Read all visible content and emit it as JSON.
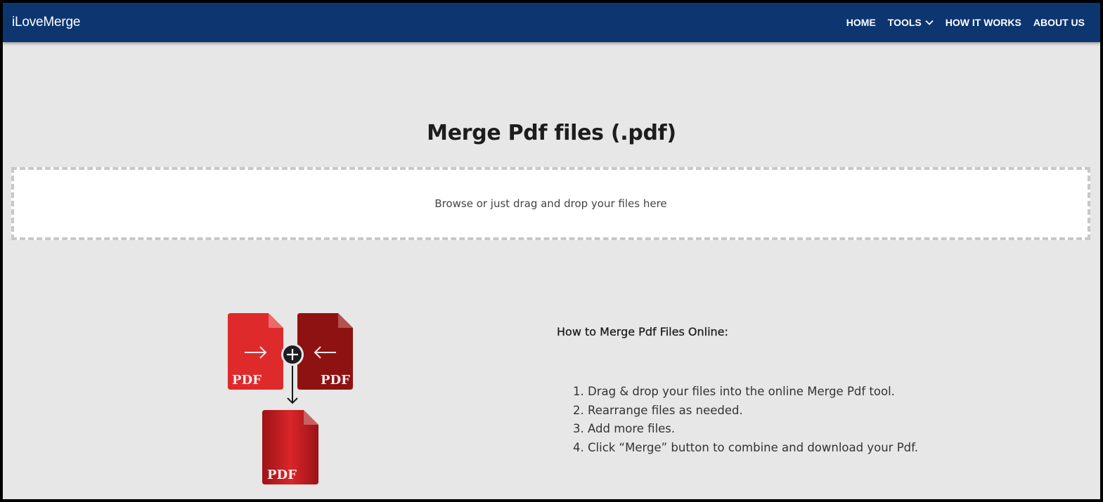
{
  "navbar": {
    "brand": "iLoveMerge",
    "links": [
      {
        "label": "HOME"
      },
      {
        "label": "TOOLS",
        "has_dropdown": true
      },
      {
        "label": "HOW IT WORKS"
      },
      {
        "label": "ABOUT US"
      }
    ],
    "colors": {
      "background": "#0d3570",
      "text": "#ffffff"
    }
  },
  "main": {
    "title": "Merge Pdf files (.pdf)",
    "dropzone_text": "Browse or just drag and drop your files here"
  },
  "illustration": {
    "icons": [
      "pdf-file-icon",
      "pdf-file-icon",
      "pdf-file-icon",
      "plus-icon",
      "arrow-down-icon",
      "arrow-right-icon",
      "arrow-left-icon"
    ],
    "file_label": "PDF",
    "colors": {
      "left_file": "#de2a2b",
      "right_file": "#8e1212",
      "merged_file": "#c41c20"
    }
  },
  "howto": {
    "heading": "How to Merge Pdf Files Online:",
    "steps": [
      "Drag & drop your files into the online Merge Pdf tool.",
      "Rearrange files as needed.",
      "Add more files.",
      "Click “Merge” button to combine and download your Pdf."
    ]
  }
}
